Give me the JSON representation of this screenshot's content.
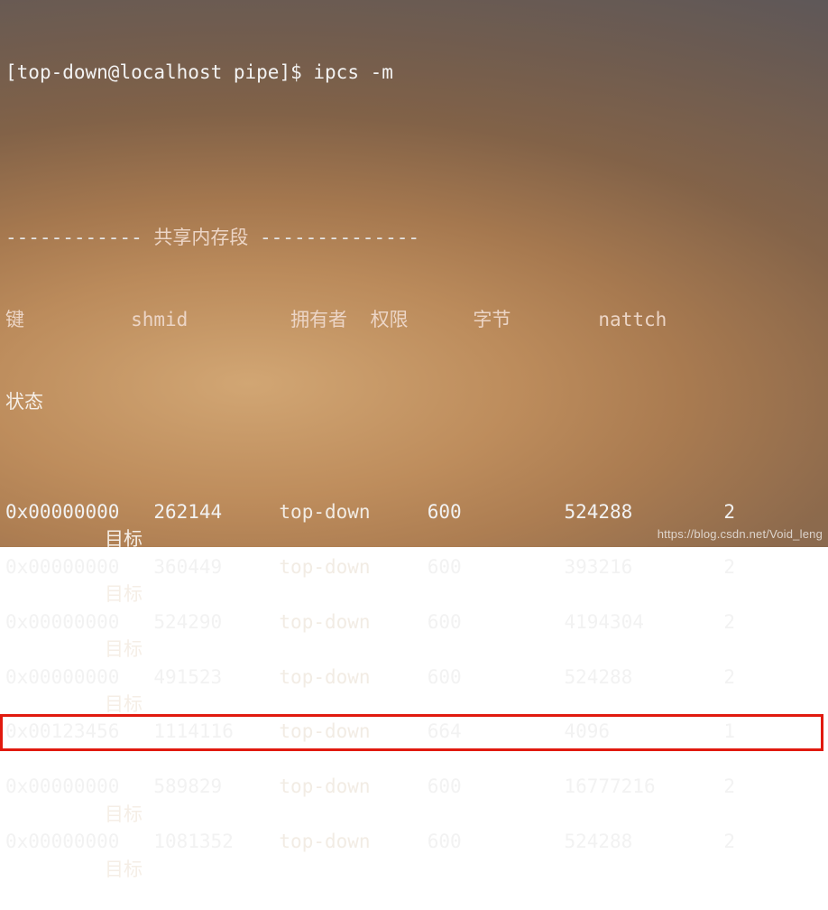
{
  "prompt": {
    "left_bracket": "[",
    "user_host": "top-down@localhost pipe",
    "right_bracket": "]$ ",
    "command": "ipcs -m"
  },
  "section_header": {
    "left_dashes": "------------ ",
    "title": "共享内存段",
    "right_dashes": " --------------"
  },
  "columns": {
    "key": "键",
    "shmid": "shmid",
    "owner": "拥有者",
    "perm": "权限",
    "bytes": "字节",
    "nattch": "nattch",
    "status": "状态"
  },
  "rows": [
    {
      "key": "0x00000000",
      "shmid": "262144",
      "owner": "top-down",
      "perm": "600",
      "bytes": "524288",
      "nattch": "2",
      "status": "目标"
    },
    {
      "key": "0x00000000",
      "shmid": "360449",
      "owner": "top-down",
      "perm": "600",
      "bytes": "393216",
      "nattch": "2",
      "status": "目标"
    },
    {
      "key": "0x00000000",
      "shmid": "524290",
      "owner": "top-down",
      "perm": "600",
      "bytes": "4194304",
      "nattch": "2",
      "status": "目标"
    },
    {
      "key": "0x00000000",
      "shmid": "491523",
      "owner": "top-down",
      "perm": "600",
      "bytes": "524288",
      "nattch": "2",
      "status": "目标"
    },
    {
      "key": "0x00123456",
      "shmid": "1114116",
      "owner": "top-down",
      "perm": "664",
      "bytes": "4096",
      "nattch": "1",
      "status": ""
    },
    {
      "key": "0x00000000",
      "shmid": "589829",
      "owner": "top-down",
      "perm": "600",
      "bytes": "16777216",
      "nattch": "2",
      "status": "目标"
    },
    {
      "key": "0x00000000",
      "shmid": "1081352",
      "owner": "top-down",
      "perm": "600",
      "bytes": "524288",
      "nattch": "2",
      "status": "目标"
    }
  ],
  "highlight_row_index": 4,
  "watermark": "https://blog.csdn.net/Void_leng"
}
